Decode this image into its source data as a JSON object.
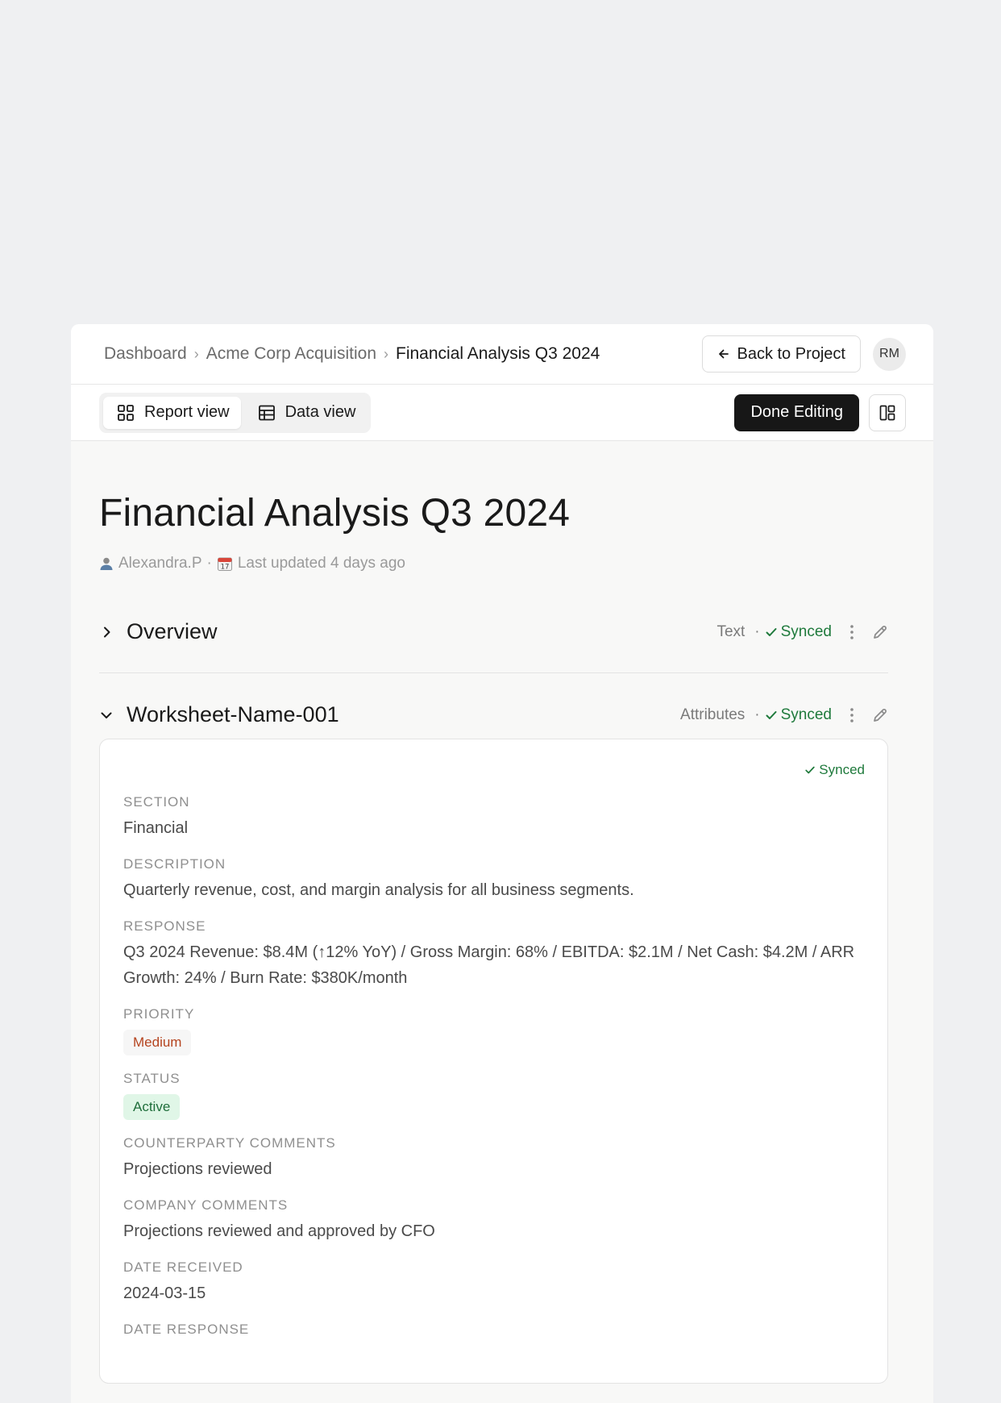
{
  "breadcrumb": {
    "items": [
      "Dashboard",
      "Acme Corp Acquisition"
    ],
    "current": "Financial Analysis Q3 2024"
  },
  "header": {
    "back_label": "Back to Project",
    "avatar_initials": "RM"
  },
  "toolbar": {
    "report_view_label": "Report view",
    "data_view_label": "Data view",
    "active_view": "report",
    "done_label": "Done Editing"
  },
  "page": {
    "title": "Financial Analysis Q3 2024",
    "author": "Alexandra.P",
    "updated": "Last updated 4 days ago",
    "meta_sep": "·"
  },
  "sections": {
    "overview": {
      "title": "Overview",
      "type": "Text",
      "status": "Synced",
      "expanded": false
    },
    "worksheet": {
      "title": "Worksheet-Name-001",
      "type": "Attributes",
      "status": "Synced",
      "expanded": true
    }
  },
  "card": {
    "status": "Synced",
    "fields": {
      "section_label": "SECTION",
      "section_value": "Financial",
      "description_label": "DESCRIPTION",
      "description_value": "Quarterly revenue, cost, and margin analysis for all business segments.",
      "response_label": "RESPONSE",
      "response_value": "Q3 2024 Revenue: $8.4M (↑12% YoY) / Gross Margin: 68% / EBITDA: $2.1M / Net Cash: $4.2M / ARR Growth: 24% / Burn Rate: $380K/month",
      "priority_label": "PRIORITY",
      "priority_value": "Medium",
      "status_label": "STATUS",
      "status_value": "Active",
      "counterparty_label": "COUNTERPARTY COMMENTS",
      "counterparty_value": "Projections reviewed",
      "company_label": "COMPANY COMMENTS",
      "company_value": "Projections reviewed and approved by CFO",
      "received_label": "DATE RECEIVED",
      "received_value": "2024-03-15",
      "response_date_label": "DATE RESPONSE"
    }
  },
  "colors": {
    "synced_green": "#1f7a3c",
    "priority_medium": "#b5441f",
    "status_active_bg": "#e0f6e7",
    "primary_button": "#171717"
  },
  "icons": {
    "back": "arrow-left-icon",
    "report": "grid-icon",
    "data": "table-icon",
    "layout": "layout-icon",
    "author": "user-icon",
    "updated": "calendar-icon",
    "collapsed": "chevron-right-icon",
    "expanded": "chevron-down-icon",
    "check": "check-icon",
    "menu": "kebab-icon",
    "edit": "pencil-icon"
  }
}
